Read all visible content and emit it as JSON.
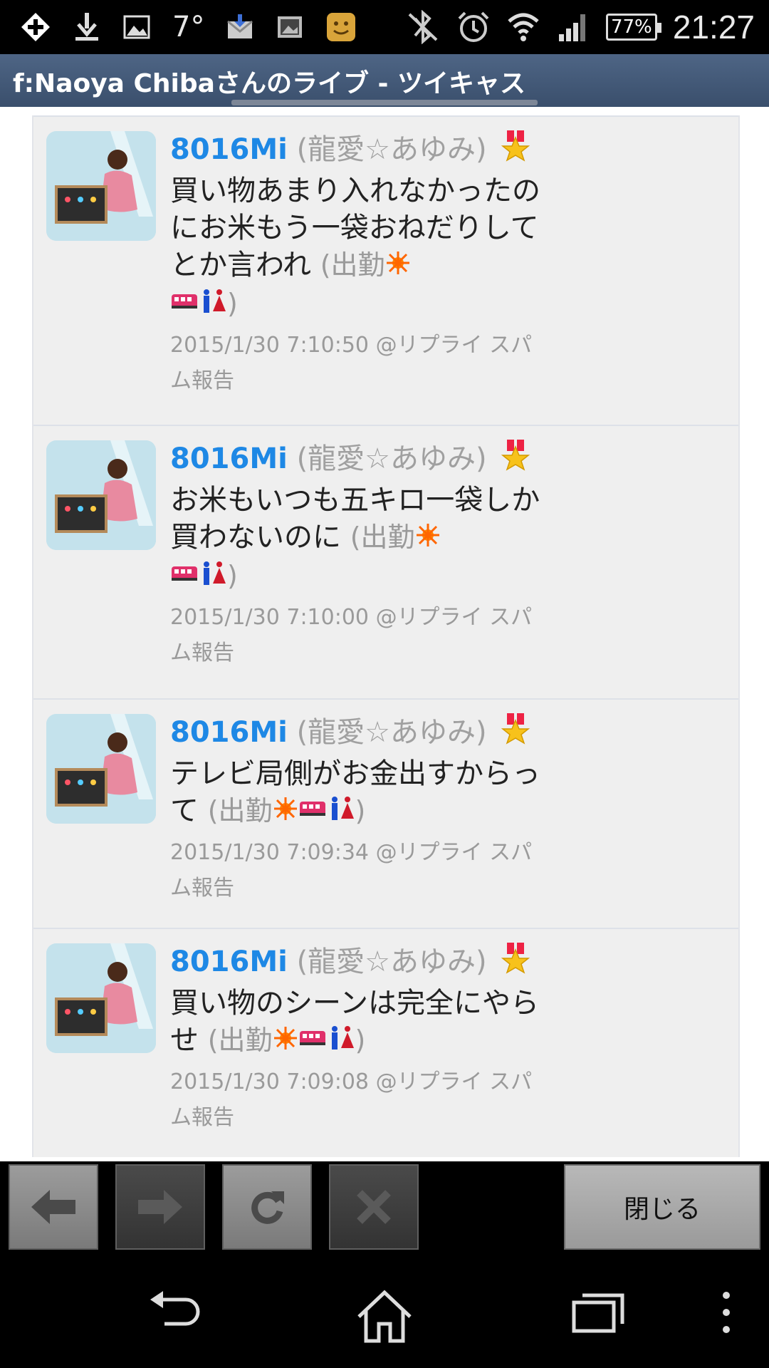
{
  "status_bar": {
    "temperature": "7°",
    "battery": "77%",
    "time": "21:27",
    "icons_left": [
      "add-icon",
      "download-icon",
      "image-icon",
      "weather-temp",
      "mail-icon",
      "photo-icon",
      "emoji-face-icon"
    ],
    "icons_right": [
      "bluetooth-off-icon",
      "alarm-icon",
      "wifi-icon",
      "signal-icon",
      "battery-icon"
    ]
  },
  "title_bar": {
    "title": "f:Naoya Chibaさんのライブ - ツイキャス"
  },
  "comments": [
    {
      "user_id": "8016Mi",
      "user_name": "(龍愛☆あゆみ)",
      "message": "買い物あまり入れなかったのにお米もう一袋おねだりしてとか言われ",
      "status_open": "(出勤",
      "status_close": ")",
      "timestamp": "2015/1/30 7:10:50",
      "reply": "@リプライ",
      "spam": "スパム報告"
    },
    {
      "user_id": "8016Mi",
      "user_name": "(龍愛☆あゆみ)",
      "message": "お米もいつも五キロ一袋しか買わないのに",
      "status_open": "(出勤",
      "status_close": ")",
      "timestamp": "2015/1/30 7:10:00",
      "reply": "@リプライ",
      "spam": "スパム報告"
    },
    {
      "user_id": "8016Mi",
      "user_name": "(龍愛☆あゆみ)",
      "message": "テレビ局側がお金出すからって",
      "status_open": "(出勤",
      "status_close": ")",
      "timestamp": "2015/1/30 7:09:34",
      "reply": "@リプライ",
      "spam": "スパム報告"
    },
    {
      "user_id": "8016Mi",
      "user_name": "(龍愛☆あゆみ)",
      "message": "買い物のシーンは完全にやらせ",
      "status_open": "(出勤",
      "status_close": ")",
      "timestamp": "2015/1/30 7:09:08",
      "reply": "@リプライ",
      "spam": "スパム報告"
    }
  ],
  "toolbar": {
    "close_label": "閉じる"
  },
  "colors": {
    "user_id": "#1e88e5",
    "title_bar": "#4a6080",
    "item_bg": "#efefef"
  }
}
